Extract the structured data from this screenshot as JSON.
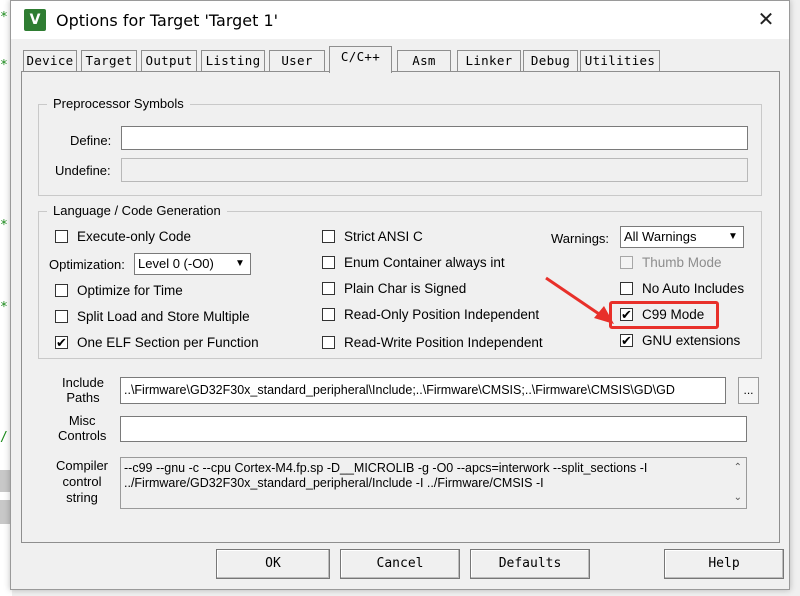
{
  "window": {
    "title": "Options for Target 'Target 1'",
    "app_icon": "uvision-icon",
    "close_glyph": "✕"
  },
  "tabs": [
    "Device",
    "Target",
    "Output",
    "Listing",
    "User",
    "C/C++",
    "Asm",
    "Linker",
    "Debug",
    "Utilities"
  ],
  "active_tab": "C/C++",
  "preprocessor": {
    "legend": "Preprocessor Symbols",
    "define_label": "Define:",
    "define_value": "",
    "undefine_label": "Undefine:",
    "undefine_value": ""
  },
  "language": {
    "legend": "Language / Code Generation",
    "execute_only": {
      "label": "Execute-only Code",
      "checked": false
    },
    "optimization_label": "Optimization:",
    "optimization_value": "Level 0 (-O0)",
    "optimize_time": {
      "label": "Optimize for Time",
      "checked": false
    },
    "split_load": {
      "label": "Split Load and Store Multiple",
      "checked": false
    },
    "one_elf": {
      "label": "One ELF Section per Function",
      "checked": true
    },
    "strict_ansi": {
      "label": "Strict ANSI C",
      "checked": false
    },
    "enum_container": {
      "label": "Enum Container always int",
      "checked": false
    },
    "plain_char": {
      "label": "Plain Char is Signed",
      "checked": false
    },
    "ro_pi": {
      "label": "Read-Only Position Independent",
      "checked": false
    },
    "rw_pi": {
      "label": "Read-Write Position Independent",
      "checked": false
    },
    "warnings_label": "Warnings:",
    "warnings_value": "All Warnings",
    "thumb_mode": {
      "label": "Thumb Mode",
      "checked": false,
      "disabled": true
    },
    "no_auto_includes": {
      "label": "No Auto Includes",
      "checked": false
    },
    "c99_mode": {
      "label": "C99 Mode",
      "checked": true
    },
    "gnu_ext": {
      "label": "GNU extensions",
      "checked": true
    }
  },
  "paths": {
    "include_label": "Include\nPaths",
    "include_value": "..\\Firmware\\GD32F30x_standard_peripheral\\Include;..\\Firmware\\CMSIS;..\\Firmware\\CMSIS\\GD\\GD",
    "browse_label": "...",
    "misc_label": "Misc\nControls",
    "misc_value": "",
    "compiler_label": "Compiler\ncontrol\nstring",
    "compiler_value": "--c99 --gnu -c --cpu Cortex-M4.fp.sp -D__MICROLIB -g -O0 --apcs=interwork --split_sections -I ../Firmware/GD32F30x_standard_peripheral/Include -I ../Firmware/CMSIS -I"
  },
  "buttons": {
    "ok": "OK",
    "cancel": "Cancel",
    "defaults": "Defaults",
    "help": "Help"
  },
  "annotation": {
    "highlight_color": "#e8302a"
  },
  "background_marks": [
    "*",
    "*",
    "*",
    "*",
    "/"
  ],
  "colors": {
    "check_mark": "✔",
    "dialog_bg": "#f0f0f0"
  }
}
